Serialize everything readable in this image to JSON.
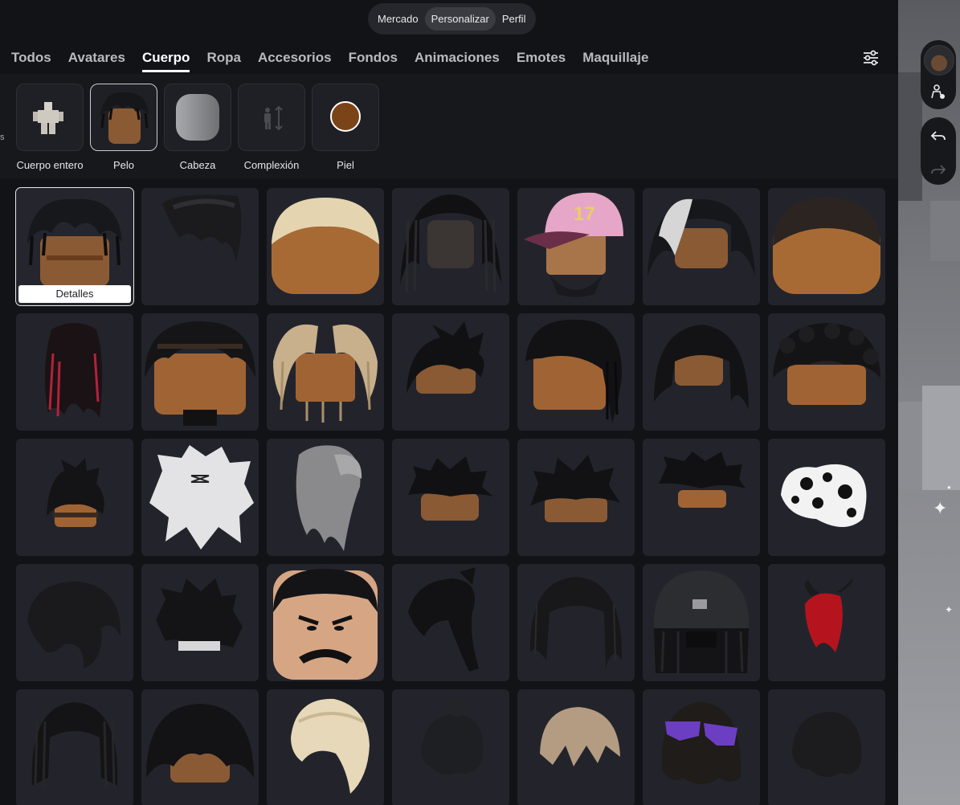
{
  "top_nav": {
    "items": [
      "Mercado",
      "Personalizar",
      "Perfil"
    ],
    "active": "Personalizar"
  },
  "tabs": [
    "Todos",
    "Avatares",
    "Cuerpo",
    "Ropa",
    "Accesorios",
    "Fondos",
    "Animaciones",
    "Emotes",
    "Maquillaje"
  ],
  "active_tab": "Cuerpo",
  "left_edge_mark": "s",
  "sub_categories": [
    {
      "label": "Cuerpo entero",
      "icon": "body-icon"
    },
    {
      "label": "Pelo",
      "icon": "hair-icon"
    },
    {
      "label": "Cabeza",
      "icon": "head-icon"
    },
    {
      "label": "Complexión",
      "icon": "scale-icon"
    },
    {
      "label": "Piel",
      "icon": "skin-color-icon"
    }
  ],
  "selected_sub": "Pelo",
  "grid": {
    "details_label": "Detalles",
    "items": [
      "hair-twists-selected",
      "hair-dark-swept",
      "hair-blonde-buzz",
      "hair-braids-long",
      "hair-pink-cap",
      "hair-white-black-twists",
      "hair-dark-buzz",
      "hair-red-long",
      "hair-twists-headband",
      "hair-blonde-locs",
      "hair-spiky-short",
      "hair-curtain-locs",
      "hair-side-twists",
      "hair-curly-top",
      "hair-spiky-brown",
      "hair-white-spiky",
      "hair-gray-ponytail",
      "hair-black-spiky",
      "hair-black-messy",
      "hair-black-fringe",
      "hair-white-black-splash",
      "hair-swept-dark",
      "hair-spiky-band",
      "hair-black-head",
      "hair-black-ponytail",
      "hair-long-dark",
      "hair-beanie-locs",
      "hair-red-horns",
      "hair-locs-black",
      "hair-curly-black",
      "hair-blonde-side",
      "hair-dark-bun",
      "hair-light-brown",
      "hair-purple-glasses",
      "hair-dark-wavy"
    ]
  },
  "colors": {
    "panel": "#121317",
    "tile": "#23242b",
    "skin": "#8a5a34",
    "skin_swatch": "#7a4418",
    "accent_pink": "#e8a8d0"
  }
}
